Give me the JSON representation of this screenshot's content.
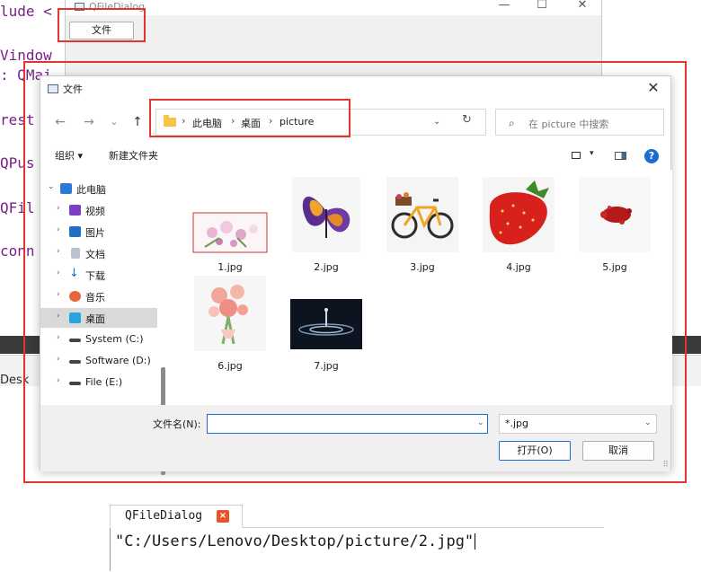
{
  "code_editor": {
    "lines": [
      "lude <",
      "Vindow",
      ": QMai",
      "rest",
      "QPus",
      "QFil",
      "conn"
    ],
    "desk_fragment": "Desk"
  },
  "main_window": {
    "title": "QFileDialog",
    "file_button": "文件",
    "minimize": "—",
    "maximize": "☐",
    "close": "✕"
  },
  "dialog": {
    "title": "文件",
    "close": "✕",
    "nav": {
      "back": "←",
      "forward": "→",
      "recent": "⌄",
      "up": "↑"
    },
    "breadcrumb": [
      "此电脑",
      "桌面",
      "picture"
    ],
    "breadcrumb_sep": "›",
    "address_dropdown": "⌄",
    "refresh": "↻",
    "search_placeholder": "在 picture 中搜索",
    "search_icon": "⌕",
    "toolbar": {
      "organize": "组织 ▾",
      "new_folder": "新建文件夹",
      "view_dropdown": "▾",
      "help": "?"
    },
    "sidebar": [
      {
        "label": "此电脑",
        "icon": "monitor-icon",
        "chevron": "⌄",
        "expanded": true
      },
      {
        "label": "视频",
        "icon": "video-icon",
        "chevron": "›"
      },
      {
        "label": "图片",
        "icon": "pictures-icon",
        "chevron": "›"
      },
      {
        "label": "文档",
        "icon": "document-icon",
        "chevron": "›"
      },
      {
        "label": "下载",
        "icon": "download-icon",
        "chevron": "›"
      },
      {
        "label": "音乐",
        "icon": "music-icon",
        "chevron": "›"
      },
      {
        "label": "桌面",
        "icon": "desktop-icon",
        "chevron": "›",
        "selected": true
      },
      {
        "label": "System (C:)",
        "icon": "drive-icon",
        "chevron": "›"
      },
      {
        "label": "Software (D:)",
        "icon": "drive-icon",
        "chevron": "›"
      },
      {
        "label": "File (E:)",
        "icon": "drive-icon",
        "chevron": "›"
      }
    ],
    "files": [
      {
        "name": "1.jpg",
        "icon": "flowers-thumbnail"
      },
      {
        "name": "2.jpg",
        "icon": "butterfly-thumbnail"
      },
      {
        "name": "3.jpg",
        "icon": "bicycle-thumbnail"
      },
      {
        "name": "4.jpg",
        "icon": "strawberry-thumbnail"
      },
      {
        "name": "5.jpg",
        "icon": "red-splash-thumbnail"
      },
      {
        "name": "6.jpg",
        "icon": "bouquet-thumbnail"
      },
      {
        "name": "7.jpg",
        "icon": "water-drop-thumbnail"
      }
    ],
    "filename_label": "文件名(N):",
    "filename_value": "",
    "filter_value": "*.jpg",
    "open_button": "打开(O)",
    "cancel_button": "取消",
    "dropdown_glyph": "⌄",
    "grip": "⠿"
  },
  "output": {
    "tab_label": "QFileDialog",
    "tab_close": "×",
    "text": "\"C:/Users/Lenovo/Desktop/picture/2.jpg\""
  },
  "colors": {
    "highlight": "#e3342f",
    "accent": "#1c6dd0",
    "code": "#7a1f8a"
  }
}
